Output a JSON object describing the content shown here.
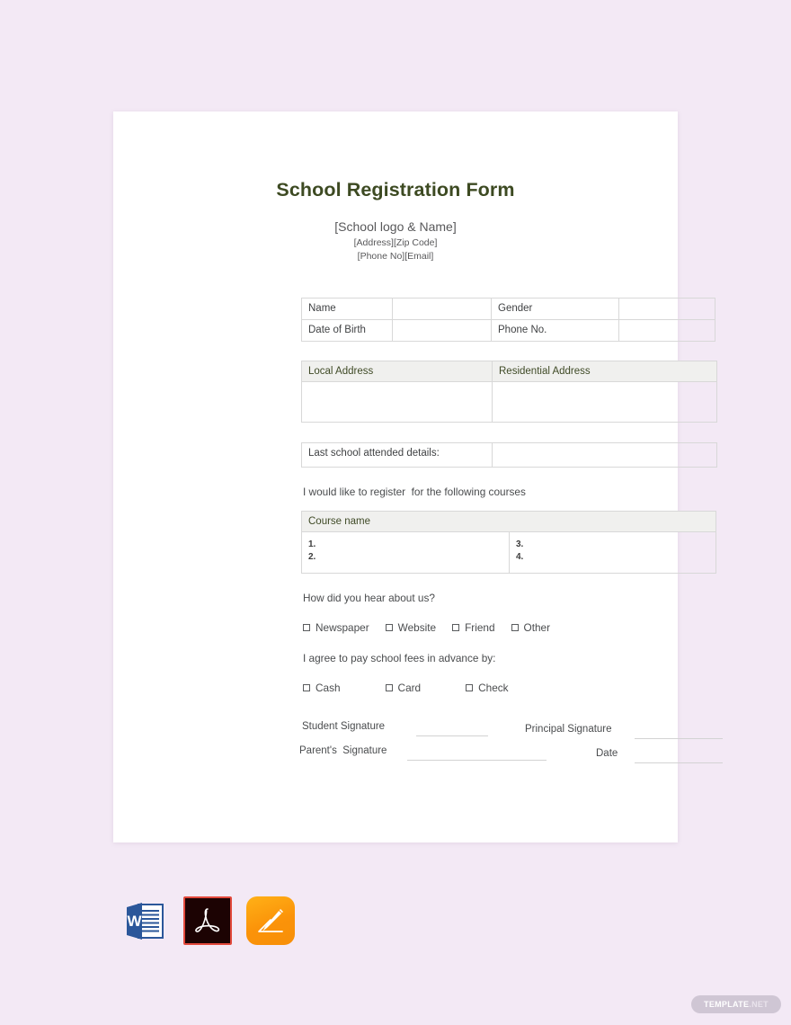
{
  "document": {
    "title": "School Registration Form",
    "subtitle_lines": [
      "[School logo & Name]",
      "[Address][Zip Code]",
      "[Phone No][Email]"
    ]
  },
  "personal_table": {
    "rows": [
      {
        "label_left": "Name",
        "value_left": "",
        "label_right": "Gender",
        "value_right": ""
      },
      {
        "label_left": "Date  of Birth",
        "value_left": "",
        "label_right": "Phone No.",
        "value_right": ""
      }
    ]
  },
  "address_table": {
    "headers": [
      "Local Address",
      "Residential Address"
    ],
    "values": [
      "",
      ""
    ]
  },
  "last_school_table": {
    "label": "Last school attended details:",
    "value": ""
  },
  "courses": {
    "intro": "I would like to register  for the following courses",
    "header": "Course name",
    "left_items": [
      "1.",
      "2."
    ],
    "right_items": [
      "3.",
      "4."
    ]
  },
  "hear_about": {
    "question": "How did you hear about us?",
    "options": [
      "Newspaper",
      "Website",
      "Friend",
      "Other"
    ]
  },
  "payment": {
    "question": "I agree to pay school fees in advance by:",
    "options": [
      "Cash",
      "Card",
      "Check"
    ]
  },
  "signatures": {
    "student_label": "Student Signature",
    "parent_label": "Parent's  Signature",
    "principal_label": "Principal Signature",
    "date_label": "Date"
  },
  "formats": [
    {
      "name": "word-doc-icon",
      "label": "W"
    },
    {
      "name": "pdf-icon",
      "label": ""
    },
    {
      "name": "apple-pages-icon",
      "label": ""
    }
  ],
  "watermark": {
    "main": "TEMPLATE",
    "suffix": ".NET"
  },
  "colors": {
    "page_background": "#f3e9f5",
    "title": "#3d4a22",
    "table_header_bg": "#f0f0ee",
    "table_header_text": "#3f4a26",
    "body_text": "#4a4c4e",
    "word_blue": "#2b579a",
    "pdf_red": "#e2493c",
    "pages_orange": "#fb9309"
  }
}
